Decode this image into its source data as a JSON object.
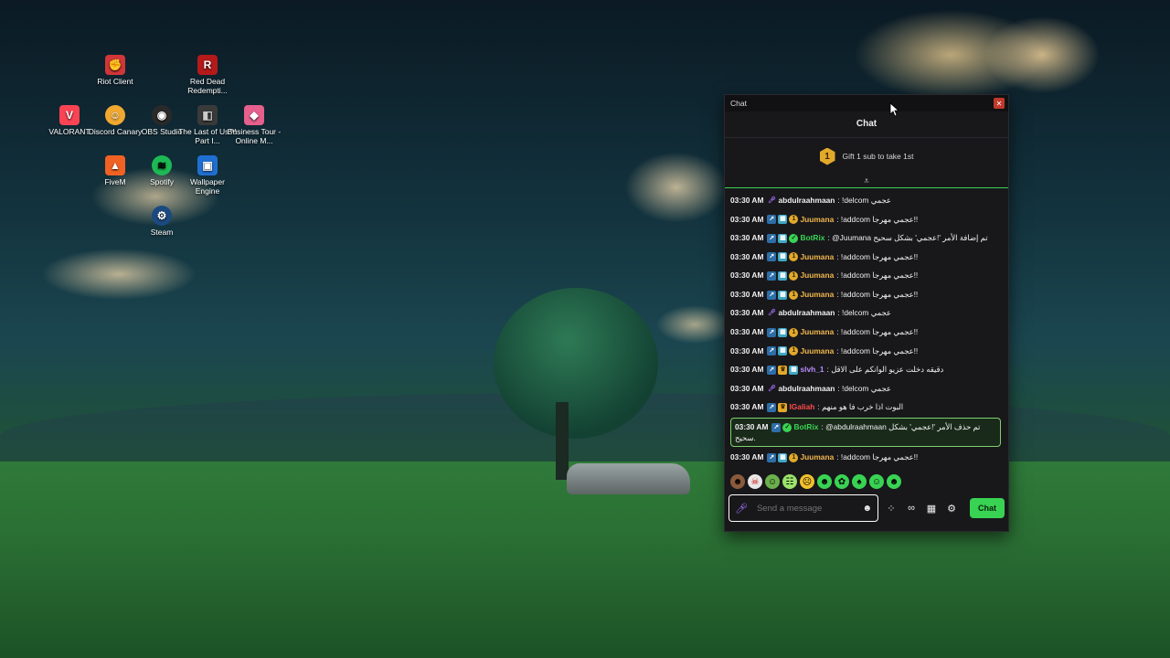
{
  "desktop": {
    "icons": [
      {
        "label": "Riot Client",
        "icon": "riot-client-icon",
        "color": "#d13639"
      },
      {
        "label": "Red Dead Redempti...",
        "icon": "red-dead-icon",
        "color": "#b51a1a"
      },
      {
        "label": "VALORANT",
        "icon": "valorant-icon",
        "color": "#fa4454"
      },
      {
        "label": "Discord Canary",
        "icon": "discord-canary-icon",
        "color": "#f0a830"
      },
      {
        "label": "OBS Studio",
        "icon": "obs-studio-icon",
        "color": "#2a2a2a"
      },
      {
        "label": "The Last of Us™ Part I...",
        "icon": "last-of-us-icon",
        "color": "#3a3a3a"
      },
      {
        "label": "Business Tour - Online M...",
        "icon": "business-tour-icon",
        "color": "#e5608c"
      },
      {
        "label": "FiveM",
        "icon": "fivem-icon",
        "color": "#f06223"
      },
      {
        "label": "Spotify",
        "icon": "spotify-icon",
        "color": "#1db954"
      },
      {
        "label": "Wallpaper Engine",
        "icon": "wallpaper-engine-icon",
        "color": "#1f6fd1"
      },
      {
        "label": "Steam",
        "icon": "steam-icon",
        "color": "#1b4a80"
      }
    ]
  },
  "chat_window": {
    "window_title": "Chat",
    "header": "Chat",
    "gift_text": "Gift 1 sub to take 1st",
    "gift_badge": "1",
    "messages": [
      {
        "time": "03:30 AM",
        "badges": [
          "mic"
        ],
        "user": "abdulraahmaan",
        "user_color": "#efeff1",
        "text": "!delcom عجمي"
      },
      {
        "time": "03:30 AM",
        "badges": [
          "arrow",
          "grid",
          "gold"
        ],
        "user": "Juumana",
        "user_color": "#f2b74a",
        "text": "!addcom عجمي مهرجا!!"
      },
      {
        "time": "03:30 AM",
        "badges": [
          "arrow",
          "grid",
          "verified"
        ],
        "user": "BotRix",
        "user_color": "#39d353",
        "text": "@Juumana تم إضافة الأمر '!عجمي' بشكل سحيح"
      },
      {
        "time": "03:30 AM",
        "badges": [
          "arrow",
          "grid",
          "gold"
        ],
        "user": "Juumana",
        "user_color": "#f2b74a",
        "text": "!addcom عجمي مهرجا!!"
      },
      {
        "time": "03:30 AM",
        "badges": [
          "arrow",
          "grid",
          "gold"
        ],
        "user": "Juumana",
        "user_color": "#f2b74a",
        "text": "!addcom عجمي مهرجا!!"
      },
      {
        "time": "03:30 AM",
        "badges": [
          "arrow",
          "grid",
          "gold"
        ],
        "user": "Juumana",
        "user_color": "#f2b74a",
        "text": "!addcom عجمي مهرجا!!"
      },
      {
        "time": "03:30 AM",
        "badges": [
          "mic"
        ],
        "user": "abdulraahmaan",
        "user_color": "#efeff1",
        "text": "!delcom عجمي"
      },
      {
        "time": "03:30 AM",
        "badges": [
          "arrow",
          "grid",
          "gold"
        ],
        "user": "Juumana",
        "user_color": "#f2b74a",
        "text": "!addcom عجمي مهرجا!!"
      },
      {
        "time": "03:30 AM",
        "badges": [
          "arrow",
          "grid",
          "gold"
        ],
        "user": "Juumana",
        "user_color": "#f2b74a",
        "text": "!addcom عجمي مهرجا!!"
      },
      {
        "time": "03:30 AM",
        "badges": [
          "arrow",
          "crown",
          "grid"
        ],
        "user": "slvh_1",
        "user_color": "#b98cff",
        "text": "دقيقه دخلت عزيو الوانكم على الاقل"
      },
      {
        "time": "03:30 AM",
        "badges": [
          "mic"
        ],
        "user": "abdulraahmaan",
        "user_color": "#efeff1",
        "text": "!delcom عجمي"
      },
      {
        "time": "03:30 AM",
        "badges": [
          "arrow",
          "crown"
        ],
        "user": "lGaliah",
        "user_color": "#ff4a4a",
        "text": "البوت اذا خرب فا هو منهم"
      },
      {
        "time": "03:30 AM",
        "badges": [
          "arrow",
          "verified"
        ],
        "user": "BotRix",
        "user_color": "#39d353",
        "text": "@abdulraahmaan تم حذف الأمر '!عجمي' بشكل سحيح.",
        "highlight": true
      },
      {
        "time": "03:30 AM",
        "badges": [
          "arrow",
          "grid",
          "gold"
        ],
        "user": "Juumana",
        "user_color": "#f2b74a",
        "text": "!addcom عجمي مهرجا!!"
      }
    ],
    "input": {
      "placeholder": "Send a message"
    },
    "send_label": "Chat"
  }
}
